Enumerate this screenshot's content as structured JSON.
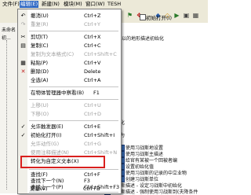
{
  "menubar": {
    "items": [
      {
        "label": "文件(F)"
      },
      {
        "label": "编辑(E)"
      },
      {
        "label": "新建(N)"
      },
      {
        "label": "模块(M)"
      },
      {
        "label": "窗口(W)"
      },
      {
        "label": "TESH"
      }
    ],
    "active_index": 1
  },
  "toolbar": {
    "checkbox_label": "初始打开(I)"
  },
  "sidebar": {
    "lines": [
      "未命名",
      "初..."
    ]
  },
  "content": {
    "lines": [
      {
        "text": "以的地形描述初始化"
      },
      {
        "text": "使用习战斯地设置"
      },
      {
        "text": "使用习战斯主描述"
      },
      {
        "text": "给官有某被一个回被者编"
      },
      {
        "text": "设置初始化值"
      },
      {
        "text": "使用习战斯的记录的中立业物"
      },
      {
        "text": "创建习战斯单位"
      },
      {
        "text": "习战斯描述 - 设定习战斯中初始化"
      },
      {
        "text": "习战斯描述 - 强制使用习战斯到(夫降条件"
      }
    ],
    "partial": [
      {
        "text": "化"
      },
      {
        "text": "为"
      }
    ]
  },
  "edit_menu": {
    "items": [
      {
        "label": "撤消(U)",
        "shortcut": "Ctrl+Z",
        "icon": "undo-icon",
        "glyph": "↶",
        "disabled": false
      },
      {
        "label": "重复(R)",
        "shortcut": "Ctrl+Y",
        "icon": "redo-icon",
        "glyph": "↷",
        "disabled": true
      },
      {
        "label": "剪切(T)",
        "shortcut": "Ctrl+X",
        "icon": "cut-icon",
        "glyph": "✂",
        "disabled": false
      },
      {
        "label": "复制(C)",
        "shortcut": "Ctrl+C",
        "icon": "copy-icon",
        "glyph": "▤",
        "disabled": false
      },
      {
        "label": "复制为文本格式(C)",
        "shortcut": "Ctrl+Shift+C",
        "icon": "",
        "glyph": "",
        "disabled": true
      },
      {
        "label": "粘贴(P)",
        "shortcut": "Ctrl+V",
        "icon": "paste-icon",
        "glyph": "▦",
        "disabled": false
      },
      {
        "label": "删除(D)",
        "shortcut": "Delete",
        "icon": "delete-icon",
        "glyph": "✕",
        "disabled": false
      },
      {
        "label": "全选(A)",
        "shortcut": "Ctrl+A",
        "icon": "",
        "glyph": "",
        "disabled": false
      },
      {
        "label": "在物体管理器中察看(B)",
        "shortcut": "F1",
        "icon": "",
        "glyph": "",
        "disabled": false
      },
      {
        "label": "上移(U)",
        "shortcut": "Ctrl+U",
        "icon": "",
        "glyph": "",
        "disabled": true
      },
      {
        "label": "下移(O)",
        "shortcut": "Ctrl+D",
        "icon": "",
        "glyph": "",
        "disabled": true
      },
      {
        "label": "允许触发器(E)",
        "shortcut": "Ctrl+E",
        "icon": "check-icon",
        "glyph": "✓",
        "disabled": false
      },
      {
        "label": "初始化打开(I)",
        "shortcut": "Ctrl+Shift+I",
        "icon": "check-icon",
        "glyph": "✓",
        "disabled": false
      },
      {
        "label": "允许动作(G)",
        "shortcut": "Ctrl+G",
        "icon": "",
        "glyph": "",
        "disabled": true
      },
      {
        "label": "使用注释描述(N)",
        "shortcut": "Ctrl+Shift+N",
        "icon": "",
        "glyph": "",
        "disabled": true
      },
      {
        "label": "转化为自定义文本(X)",
        "shortcut": "",
        "icon": "",
        "glyph": "",
        "disabled": false
      },
      {
        "label": "查找(F)",
        "shortcut": "Ctrl+F",
        "icon": "",
        "glyph": "",
        "disabled": false
      },
      {
        "label": "查找下一个(N)",
        "shortcut": "F3",
        "icon": "",
        "glyph": "",
        "disabled": false
      },
      {
        "label": "查找上一个(P)",
        "shortcut": "Ctrl+Shift+F3",
        "icon": "",
        "glyph": "",
        "disabled": false
      },
      {
        "label": "变量(V)",
        "shortcut": "Ctrl+B",
        "icon": "",
        "glyph": "",
        "disabled": false
      }
    ],
    "highlighted_item_index": 15,
    "highlight_color": "#d9201e"
  },
  "colors": {
    "menu_active": "#316ac5",
    "toolbar_bg": "#ece9d8"
  }
}
